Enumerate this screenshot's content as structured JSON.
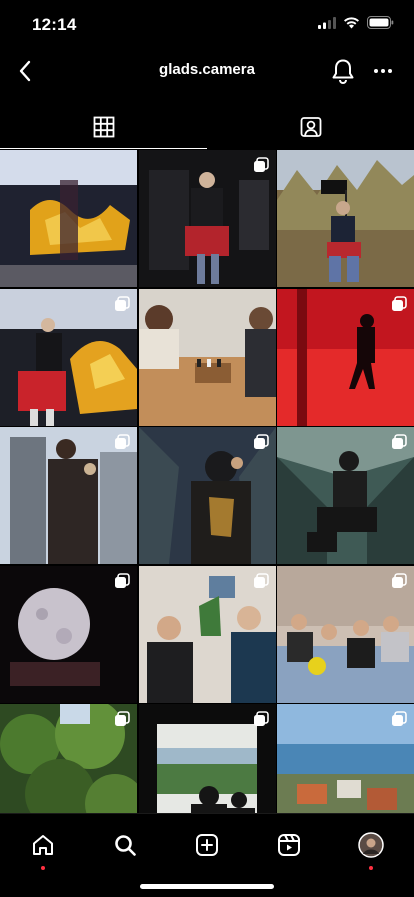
{
  "status_bar": {
    "time": "12:14",
    "icons": [
      "cellular-signal-icon",
      "wifi-icon",
      "battery-icon"
    ]
  },
  "header": {
    "title": "glads.camera",
    "icons": [
      "back-chevron-icon",
      "bell-icon",
      "more-icon"
    ]
  },
  "tabs": [
    {
      "icon": "grid-icon",
      "active": true
    },
    {
      "icon": "tagged-icon",
      "active": false
    }
  ],
  "grid": {
    "posts": [
      {
        "desc": "graffiti wall with person",
        "multi": false
      },
      {
        "desc": "man in plaid kilt dark room",
        "multi": true
      },
      {
        "desc": "man seated outdoors by sign",
        "multi": false
      },
      {
        "desc": "man in red kilt by graffiti",
        "multi": true
      },
      {
        "desc": "two people playing chess",
        "multi": false
      },
      {
        "desc": "figure in red room",
        "multi": true
      },
      {
        "desc": "man by tall buildings",
        "multi": true
      },
      {
        "desc": "hooded man low angle",
        "multi": true
      },
      {
        "desc": "man sitting on escalator",
        "multi": true
      },
      {
        "desc": "moon lamp",
        "multi": true
      },
      {
        "desc": "two friends indoors",
        "multi": true
      },
      {
        "desc": "group of friends on couch",
        "multi": true
      },
      {
        "desc": "green trees",
        "multi": true
      },
      {
        "desc": "silhouettes at window",
        "multi": true
      },
      {
        "desc": "coastal town view",
        "multi": true
      }
    ]
  },
  "nav": {
    "items": [
      {
        "icon": "home-icon",
        "notify": true
      },
      {
        "icon": "search-icon",
        "notify": false
      },
      {
        "icon": "create-icon",
        "notify": false
      },
      {
        "icon": "reels-icon",
        "notify": false
      },
      {
        "icon": "profile-avatar",
        "notify": true
      }
    ]
  },
  "colors": {
    "background": "#000000",
    "notification": "#ff3040",
    "text": "#ffffff"
  }
}
